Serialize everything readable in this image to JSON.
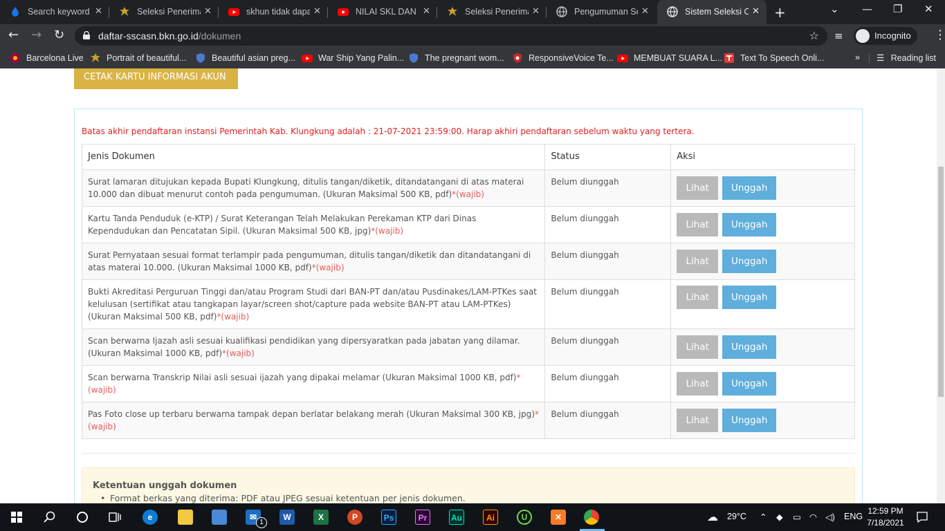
{
  "browser": {
    "tabs": [
      {
        "title": "Search keyword c",
        "favicon": "drop-icon"
      },
      {
        "title": "Seleksi Penerimaa",
        "favicon": "garuda-icon"
      },
      {
        "title": "skhun tidak dapat",
        "favicon": "youtube-icon"
      },
      {
        "title": "NILAI SKL DAN IJ",
        "favicon": "youtube-icon"
      },
      {
        "title": "Seleksi Penerimaa",
        "favicon": "garuda-icon"
      },
      {
        "title": "Pengumuman Sel",
        "favicon": "globe-icon"
      },
      {
        "title": "Sistem Seleksi CA",
        "favicon": "globe-icon",
        "active": true
      }
    ],
    "new_tab": "+",
    "address": {
      "host": "daftar-sscasn.bkn.go.id",
      "path": "/dokumen"
    },
    "incognito_label": "Incognito",
    "bookmarks": [
      {
        "label": "Barcelona Live",
        "icon": "fcb-icon"
      },
      {
        "label": "Portrait of beautiful...",
        "icon": "pin-icon"
      },
      {
        "label": "Beautiful asian preg...",
        "icon": "shield-icon"
      },
      {
        "label": "War Ship Yang Palin...",
        "icon": "youtube-icon"
      },
      {
        "label": "The pregnant wom...",
        "icon": "shield-icon"
      },
      {
        "label": "ResponsiveVoice Te...",
        "icon": "rv-icon"
      },
      {
        "label": "MEMBUAT SUARA L...",
        "icon": "youtube-icon"
      },
      {
        "label": "Text To Speech Onli...",
        "icon": "tts-icon"
      }
    ],
    "more_bookmarks": "»",
    "reading_list": "Reading list"
  },
  "page": {
    "cetak_button": "CETAK KARTU INFORMASI AKUN",
    "deadline_notice": "Batas akhir pendaftaran instansi Pemerintah Kab. Klungkung adalah : 21-07-2021 23:59:00. Harap akhiri pendaftaran sebelum waktu yang tertera.",
    "table": {
      "headers": [
        "Jenis Dokumen",
        "Status",
        "Aksi"
      ],
      "rows": [
        {
          "doc": "Surat lamaran ditujukan kepada Bupati Klungkung, ditulis tangan/diketik, ditandatangani di atas materai 10.000 dan dibuat menurut contoh pada pengumuman. (Ukuran Maksimal 500 KB, pdf)",
          "req": "*(wajib)",
          "status": "Belum diunggah"
        },
        {
          "doc": "Kartu Tanda Penduduk (e-KTP) / Surat Keterangan Telah Melakukan Perekaman KTP dari Dinas Kependudukan dan Pencatatan Sipil. (Ukuran Maksimal 500 KB, jpg)",
          "req": "*(wajib)",
          "status": "Belum diunggah"
        },
        {
          "doc": "Surat Pernyataan sesuai format terlampir pada pengumuman, ditulis tangan/diketik dan ditandatangani di atas materai 10.000. (Ukuran Maksimal 1000 KB, pdf)",
          "req": "*(wajib)",
          "status": "Belum diunggah"
        },
        {
          "doc": "Bukti Akreditasi Perguruan Tinggi dan/atau Program Studi dari BAN-PT dan/atau Pusdinakes/LAM-PTKes saat kelulusan (sertifikat atau tangkapan layar/screen shot/capture pada website BAN-PT atau LAM-PTKes) (Ukuran Maksimal 500 KB, pdf)",
          "req": "*(wajib)",
          "status": "Belum diunggah"
        },
        {
          "doc": "Scan berwarna Ijazah asli sesuai kualifikasi pendidikan yang dipersyaratkan pada jabatan yang dilamar. (Ukuran Maksimal 1000 KB, pdf)",
          "req": "*(wajib)",
          "status": "Belum diunggah"
        },
        {
          "doc": "Scan berwarna Transkrip Nilai asli sesuai ijazah yang dipakai melamar (Ukuran Maksimal 1000 KB, pdf)",
          "req": "*(wajib)",
          "status": "Belum diunggah"
        },
        {
          "doc": "Pas Foto close up terbaru berwarna tampak depan berlatar belakang merah (Ukuran Maksimal 300 KB, jpg)",
          "req": "*(wajib)",
          "status": "Belum diunggah"
        }
      ],
      "lihat_label": "Lihat",
      "unggah_label": "Unggah"
    },
    "info": {
      "title": "Ketentuan unggah dokumen",
      "items": [
        "Format berkas yang diterima: PDF atau JPEG sesuai ketentuan per jenis dokumen."
      ]
    }
  },
  "taskbar": {
    "apps": [
      "start",
      "search",
      "cortana",
      "taskview",
      "edge",
      "explorer",
      "store",
      "outlook",
      "word",
      "excel",
      "powerpoint",
      "photoshop",
      "premiere",
      "audition",
      "illustrator",
      "upwork",
      "xampp",
      "chrome"
    ],
    "weather": "29°C",
    "language": "ENG",
    "time": "12:59 PM",
    "date": "7/18/2021",
    "mail_badge": "1"
  },
  "colors": {
    "cetak": "#d9b444",
    "unggah": "#5faedc",
    "lihat": "#b9b9b9",
    "deadline": "#e0201e",
    "required": "#e85a5a"
  }
}
